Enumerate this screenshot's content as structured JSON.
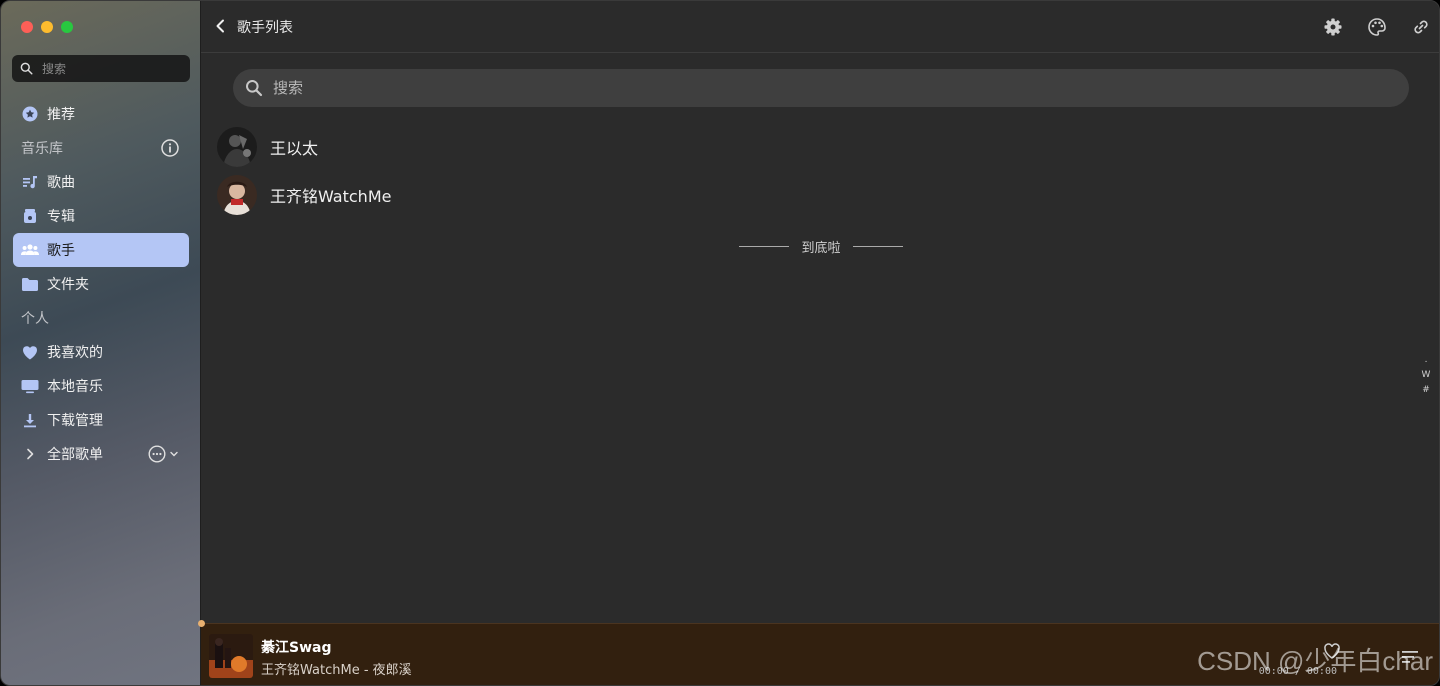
{
  "sidebar": {
    "search_placeholder": "搜索",
    "items": [
      {
        "label": "推荐",
        "icon": "star-icon"
      },
      {
        "label": "音乐库",
        "section": true,
        "icon": "info-icon"
      },
      {
        "label": "歌曲",
        "icon": "music-note-icon"
      },
      {
        "label": "专辑",
        "icon": "album-icon"
      },
      {
        "label": "歌手",
        "icon": "people-icon",
        "active": true
      },
      {
        "label": "文件夹",
        "icon": "folder-icon"
      },
      {
        "label": "个人",
        "section": true
      },
      {
        "label": "我喜欢的",
        "icon": "heart-icon"
      },
      {
        "label": "本地音乐",
        "icon": "monitor-icon"
      },
      {
        "label": "下载管理",
        "icon": "download-icon"
      },
      {
        "label": "全部歌单",
        "icon": "chevron-right-icon"
      }
    ]
  },
  "header": {
    "title": "歌手列表",
    "tools": [
      "settings-icon",
      "palette-icon",
      "link-icon"
    ]
  },
  "main": {
    "search_placeholder": "搜索",
    "artists": [
      {
        "name": "王以太"
      },
      {
        "name": "王齐铭WatchMe"
      }
    ],
    "end_text": "到底啦",
    "index": [
      ".",
      "W",
      "#"
    ]
  },
  "player": {
    "song_title": "綦江Swag",
    "song_subtitle": "王齐铭WatchMe - 夜郎溪",
    "time": "00:00 / 00:00"
  },
  "watermark": "CSDN @少年白char",
  "colors": {
    "accent": "#b4c6f5",
    "player_bg": "#32200f",
    "main_bg": "#2b2b2b"
  }
}
